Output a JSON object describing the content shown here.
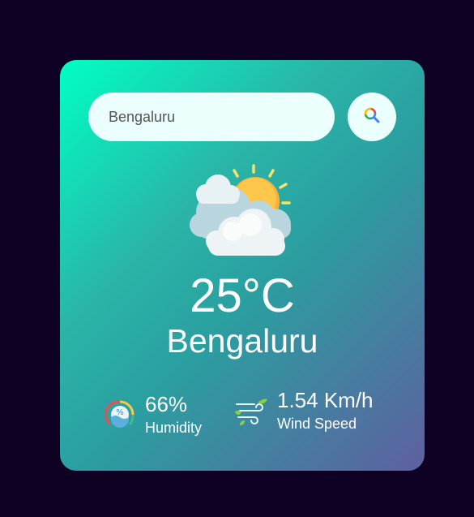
{
  "search": {
    "value": "Bengaluru",
    "icon": "search-icon"
  },
  "weather": {
    "icon": "partly-cloudy-sun-icon",
    "temperature": "25°C",
    "city": "Bengaluru"
  },
  "humidity": {
    "value": "66%",
    "label": "Humidity",
    "icon": "humidity-icon"
  },
  "wind": {
    "value": "1.54 Km/h",
    "label": "Wind Speed",
    "icon": "wind-icon"
  },
  "colors": {
    "background": "#0e0124",
    "card_gradient_start": "#00ffc3",
    "card_gradient_end": "#5f5fa0",
    "input_background": "#ebfffc"
  }
}
